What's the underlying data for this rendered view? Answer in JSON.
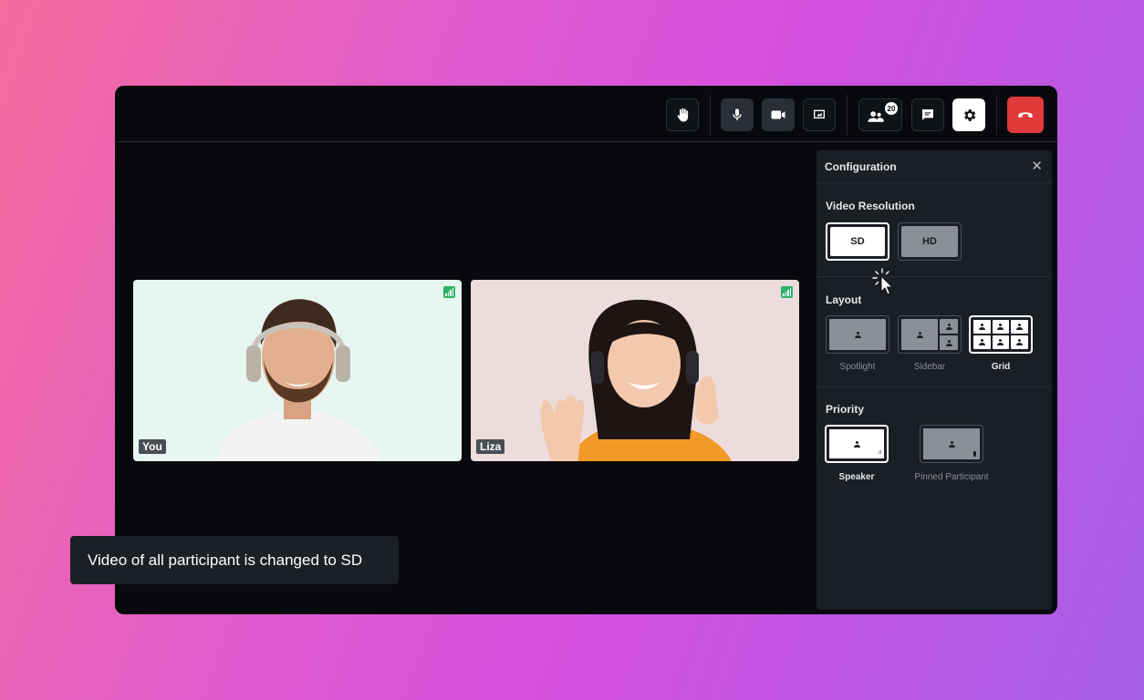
{
  "toolbar": {
    "participants_count": "20",
    "icons": [
      "raise-hand-icon",
      "microphone-icon",
      "video-camera-icon",
      "screen-share-icon",
      "participants-icon",
      "chat-icon",
      "settings-icon",
      "end-call-icon"
    ],
    "end_call_color": "#e03a3a"
  },
  "participants": [
    {
      "name": "You"
    },
    {
      "name": "Liza"
    }
  ],
  "configuration": {
    "title": "Configuration",
    "video_resolution": {
      "title": "Video Resolution",
      "options": [
        "SD",
        "HD"
      ],
      "selected": "SD"
    },
    "layout": {
      "title": "Layout",
      "options": [
        "Spotlight",
        "Sidebar",
        "Grid"
      ],
      "selected": "Grid"
    },
    "priority": {
      "title": "Priority",
      "options": [
        "Speaker",
        "Pinned Participant"
      ],
      "selected": "Speaker"
    }
  },
  "toast": {
    "message": "Video of all participant is changed to SD"
  }
}
